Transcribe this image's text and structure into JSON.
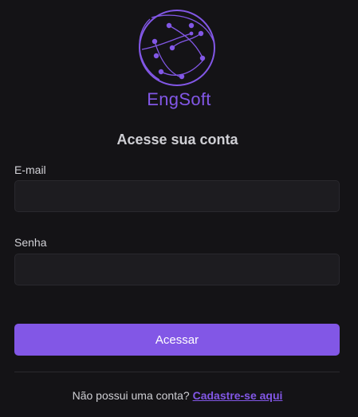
{
  "brand": {
    "name": "EngSoft",
    "logo_icon": "network-globe-icon",
    "accent_color": "#8257e6"
  },
  "form": {
    "heading": "Acesse sua conta",
    "email_label": "E-mail",
    "email_value": "",
    "password_label": "Senha",
    "password_value": "",
    "submit_label": "Acessar"
  },
  "footer": {
    "prompt": "Não possui uma conta?",
    "signup_link": "Cadastre-se aqui"
  }
}
